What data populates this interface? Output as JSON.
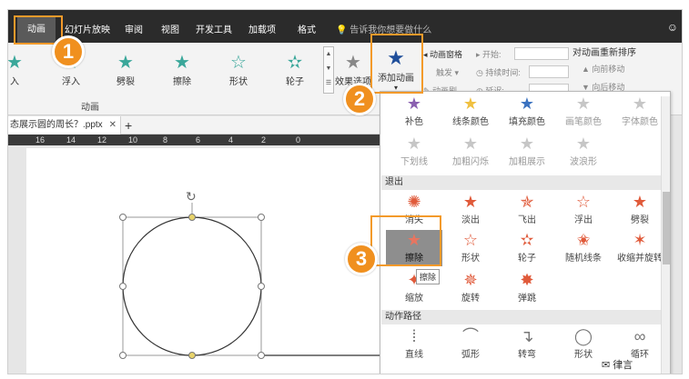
{
  "menubar": {
    "tabs": [
      "动画",
      "幻灯片放映",
      "审阅",
      "视图",
      "开发工具",
      "加载项",
      "格式"
    ],
    "tell_me": "告诉我你想要做什么",
    "user_icon": "user-icon"
  },
  "ribbon": {
    "effects": [
      {
        "label": "入",
        "color": "#3aa79a"
      },
      {
        "label": "浮入",
        "color": "#3aa79a"
      },
      {
        "label": "劈裂",
        "color": "#3aa79a"
      },
      {
        "label": "擦除",
        "color": "#3aa79a"
      },
      {
        "label": "形状",
        "color": "#3aa79a"
      },
      {
        "label": "轮子",
        "color": "#3aa79a"
      }
    ],
    "effect_options": "效果选项",
    "group_label": "动画",
    "add_animation": "添加动画",
    "pane": "动画窗格",
    "trigger": "触发",
    "painter": "动画刷",
    "start_label": "开始:",
    "duration_label": "持续时间:",
    "delay_label": "延迟:",
    "reorder_title": "对动画重新排序",
    "move_earlier": "向前移动",
    "move_later": "向后移动"
  },
  "document": {
    "tab_title": "态展示圆的周长？.pptx",
    "ruler_ticks": [
      "16",
      "14",
      "12",
      "10",
      "8",
      "6",
      "4",
      "2",
      "0"
    ]
  },
  "dropdown": {
    "emphasis_row1": [
      {
        "label": "补色",
        "color": "#8a5fb0"
      },
      {
        "label": "线条颜色",
        "color": "#f0c040"
      },
      {
        "label": "填充颜色",
        "color": "#3a72c0"
      },
      {
        "label": "画笔颜色",
        "color": "#c6c6c6"
      },
      {
        "label": "字体颜色",
        "color": "#c6c6c6"
      }
    ],
    "emphasis_row2": [
      "下划线",
      "加粗闪烁",
      "加粗展示",
      "波浪形"
    ],
    "exit_header": "退出",
    "exit_row1": [
      "消失",
      "淡出",
      "飞出",
      "浮出",
      "劈裂"
    ],
    "exit_row2": [
      "擦除",
      "形状",
      "轮子",
      "随机线条",
      "收缩并旋转"
    ],
    "exit_row3": [
      "缩放",
      "旋转",
      "弹跳"
    ],
    "exit_color": "#e05a3a",
    "path_header": "动作路径",
    "path_row": [
      "直线",
      "弧形",
      "转弯",
      "形状",
      "循环"
    ],
    "tooltip": "擦除"
  },
  "callouts": [
    "1",
    "2",
    "3"
  ],
  "colors": {
    "accent": "#f0901f",
    "dark": "#2b2b2b",
    "exit": "#e05a3a",
    "entrance": "#3aa79a"
  },
  "watermark": "律言"
}
